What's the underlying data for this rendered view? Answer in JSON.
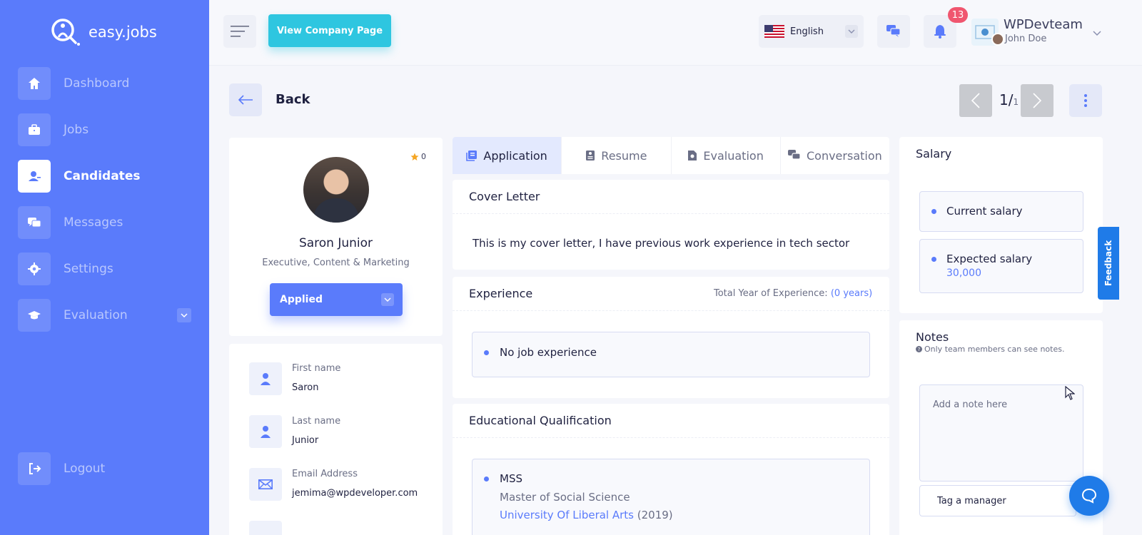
{
  "brand": {
    "name": "easy.jobs"
  },
  "sidebar": {
    "items": [
      {
        "label": "Dashboard",
        "icon": "home-icon"
      },
      {
        "label": "Jobs",
        "icon": "briefcase-icon"
      },
      {
        "label": "Candidates",
        "icon": "user-icon",
        "active": true
      },
      {
        "label": "Messages",
        "icon": "chat-icon"
      },
      {
        "label": "Settings",
        "icon": "gear-icon"
      },
      {
        "label": "Evaluation",
        "icon": "graduation-cap-icon"
      }
    ],
    "logout_label": "Logout"
  },
  "topbar": {
    "company_page_label": "View Company Page",
    "language": "English",
    "notification_count": "13",
    "company_name": "WPDevteam",
    "user_name": "John Doe"
  },
  "page": {
    "back_label": "Back",
    "pager_current": "1/",
    "pager_total": "1"
  },
  "candidate": {
    "rating": "0",
    "name": "Saron Junior",
    "role": "Executive, Content & Marketing",
    "status": "Applied",
    "fields": [
      {
        "label": "First name",
        "value": "Saron"
      },
      {
        "label": "Last name",
        "value": "Junior"
      },
      {
        "label": "Email Address",
        "value": "jemima@wpdeveloper.com"
      }
    ]
  },
  "tabs": [
    {
      "label": "Application",
      "active": true
    },
    {
      "label": "Resume"
    },
    {
      "label": "Evaluation"
    },
    {
      "label": "Conversation"
    }
  ],
  "cover_letter": {
    "title": "Cover Letter",
    "text": "This is my cover letter, I have previous work experience in tech sector"
  },
  "experience": {
    "title": "Experience",
    "total_label": "Total Year of Experience:",
    "total_value": "(0 years)",
    "empty_text": "No job experience"
  },
  "education": {
    "title": "Educational Qualification",
    "degree": "MSS",
    "degree_full": "Master of Social Science",
    "institution": "University Of Liberal Arts",
    "year": "(2019)"
  },
  "salary": {
    "title": "Salary",
    "current_label": "Current salary",
    "expected_label": "Expected salary",
    "expected_value": "30,000"
  },
  "notes": {
    "title": "Notes",
    "hint": "Only team members can see notes.",
    "placeholder": "Add a note here",
    "tag_placeholder": "Tag a manager"
  },
  "feedback_label": "Feedback",
  "colors": {
    "primary": "#5a7bfb",
    "accent": "#2ec6e0",
    "badge": "#f0566f",
    "feedback": "#1f7be8"
  }
}
